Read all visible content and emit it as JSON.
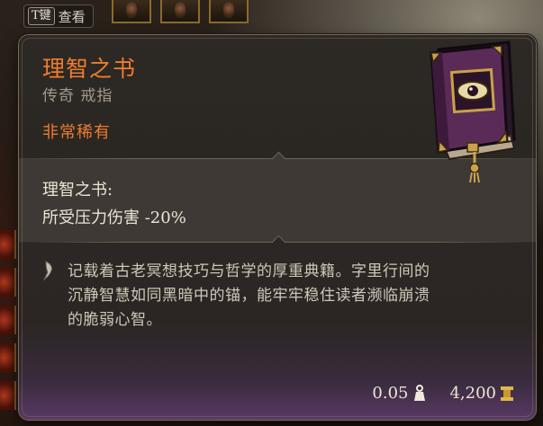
{
  "hud": {
    "inspect_key": "T键",
    "inspect_label": "查看"
  },
  "tooltip": {
    "item_name": "理智之书",
    "item_type": "传奇 戒指",
    "rarity": "非常稀有",
    "passive": {
      "name": "理智之书:",
      "effect": "所受压力伤害 -20%"
    },
    "flavor_lines": [
      "记载着古老冥想技巧与哲学的厚重典籍。字里行间的",
      "沉静智慧如同黑暗中的锚，能牢牢稳住读者濒临崩溃",
      "的脆弱心智。"
    ],
    "weight": "0.05",
    "price": "4,200",
    "icons": {
      "item": "book-of-sanity-icon",
      "flavor": "quill-icon",
      "weight": "weight-icon",
      "price": "gold-coin-icon"
    }
  },
  "colors": {
    "rarity_orange": "#ef7d2e",
    "text_main": "#ece4d4",
    "text_muted": "#a49a8c",
    "tooltip_bg": "#24201d",
    "stats_bg": "#3e3935",
    "book_purple": "#5b2b57"
  }
}
